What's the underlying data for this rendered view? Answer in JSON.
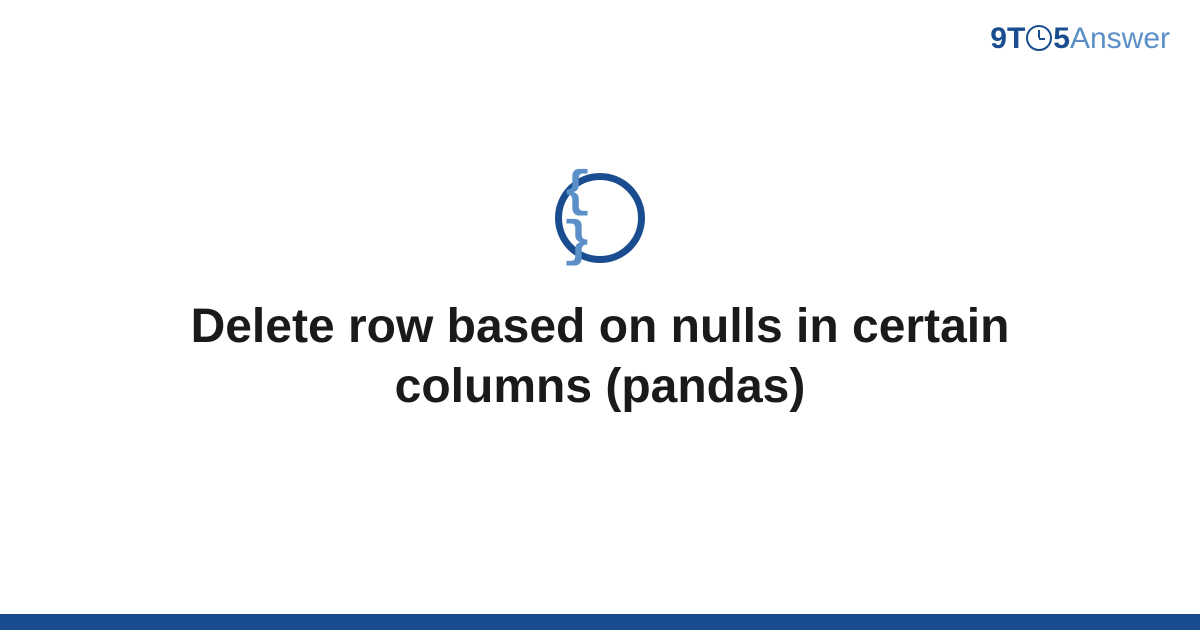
{
  "brand": {
    "nine": "9",
    "t": "T",
    "five": "5",
    "answer": "Answer"
  },
  "icon": {
    "braces": "{ }"
  },
  "title": "Delete row based on nulls in certain columns (pandas)",
  "colors": {
    "primary": "#1a4d8f",
    "secondary": "#5a8fc7"
  }
}
